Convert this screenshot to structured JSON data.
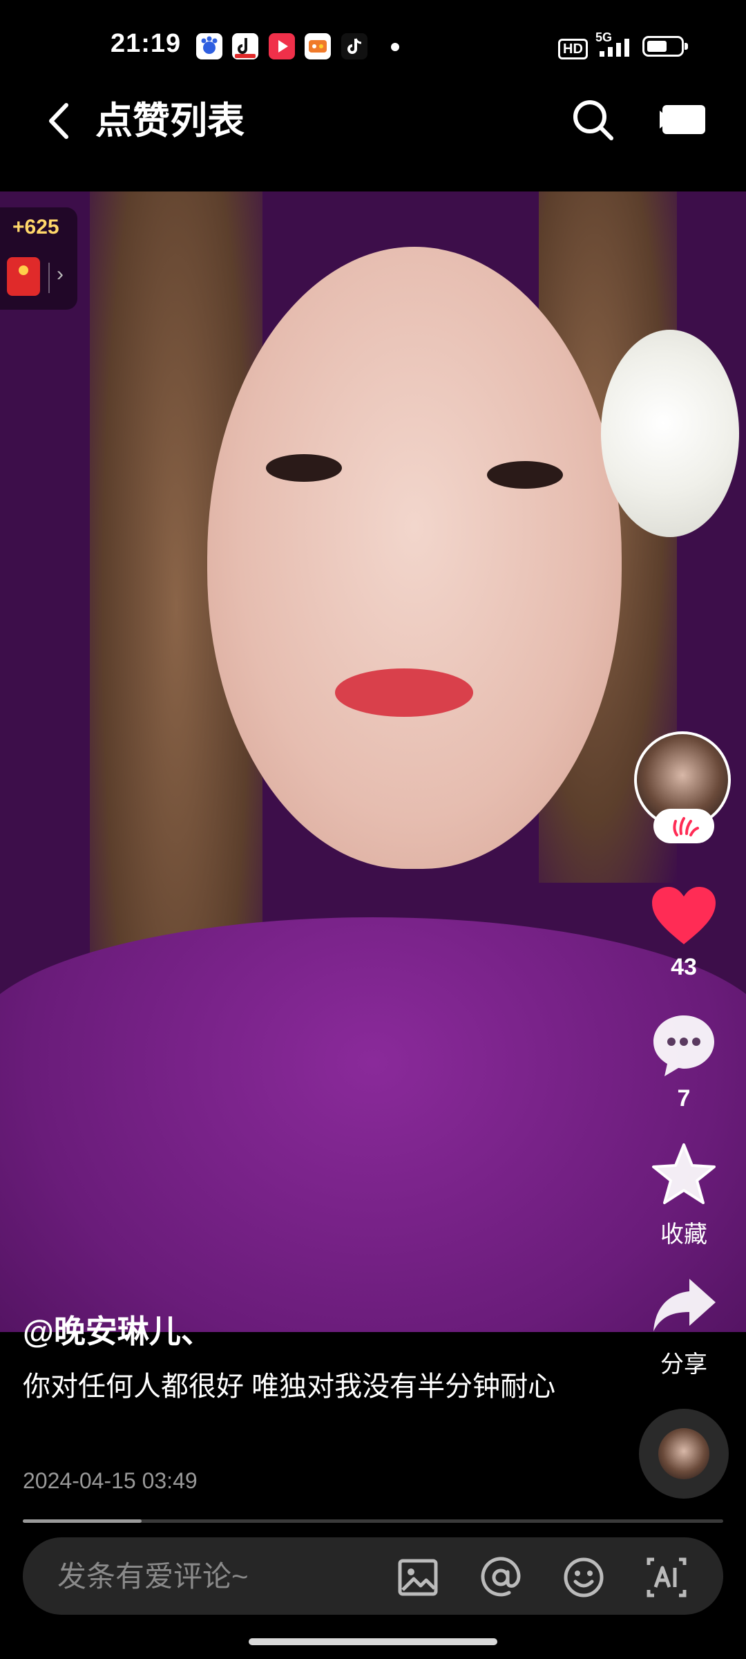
{
  "status_bar": {
    "time": "21:19",
    "hd_label": "HD",
    "network_label": "5G",
    "battery_level": 0.6,
    "notification_icons": [
      "baidu-icon",
      "douyin-icon",
      "video-play-icon",
      "game-icon",
      "tiktok-icon"
    ]
  },
  "header": {
    "back_icon": "chevron-left-icon",
    "title": "点赞列表",
    "search_icon": "search-icon",
    "camera_icon": "video-camera-icon"
  },
  "reward": {
    "amount": "+625",
    "icon": "red-packet-icon"
  },
  "actions": {
    "like_count": "43",
    "comment_count": "7",
    "favorite_label": "收藏",
    "share_label": "分享"
  },
  "post": {
    "author": "@晚安琳儿、",
    "description": "你对任何人都很好 唯独对我没有半分钟耐心",
    "date": "2024-04-15 03:49",
    "progress": 0.17
  },
  "comment_bar": {
    "placeholder": "发条有爱评论~",
    "icons": [
      "image-icon",
      "at-icon",
      "emoji-icon",
      "ai-icon"
    ]
  },
  "colors": {
    "background": "#000000",
    "like_red": "#ff2c55",
    "reward_gold": "#ffd76a",
    "comment_bar": "#262626"
  }
}
